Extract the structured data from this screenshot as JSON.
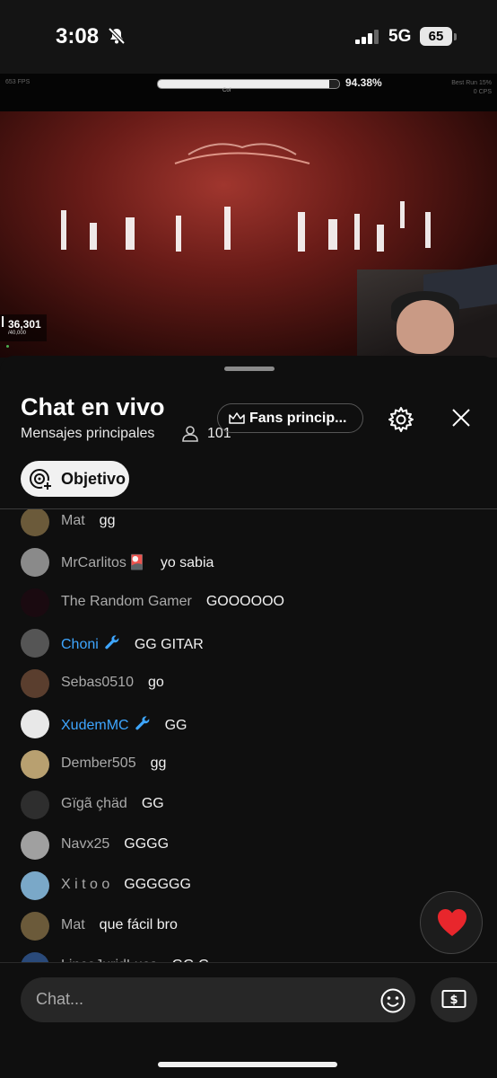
{
  "status_bar": {
    "time": "3:08",
    "network": "5G",
    "battery": "65"
  },
  "video": {
    "hud_fps": "653 FPS",
    "hud_label": "Cof",
    "hud_percent": "94.38%",
    "hud_progress": 0.9438,
    "hud_right": [
      "Best Run 15%",
      "0 CPS"
    ],
    "counter_main": "36,301",
    "counter_sub": "/40,000"
  },
  "chat": {
    "title": "Chat en vivo",
    "subtitle": "Mensajes principales",
    "viewer_count": "101",
    "fans_label": "Fans princip...",
    "goal_label": "Objetivo",
    "input_placeholder": "Chat..."
  },
  "messages": [
    {
      "author": "Mat",
      "text": "gg",
      "mod": false,
      "badge": "",
      "avatar_color": "#6b5a3a"
    },
    {
      "author": "MrCarlitos",
      "text": "yo sabia",
      "mod": false,
      "badge": "🎴",
      "avatar_color": "#8a8a8a"
    },
    {
      "author": "The Random Gamer",
      "text": "GOOOOOO",
      "mod": false,
      "badge": "",
      "avatar_color": "#1a0a10"
    },
    {
      "author": "Choni",
      "text": "GG GITAR",
      "mod": true,
      "badge": "",
      "avatar_color": "#555555"
    },
    {
      "author": "Sebas0510",
      "text": "go",
      "mod": false,
      "badge": "",
      "avatar_color": "#5a3e2e"
    },
    {
      "author": "XudemMC",
      "text": "GG",
      "mod": true,
      "badge": "",
      "avatar_color": "#e8e8e8"
    },
    {
      "author": "Dember505",
      "text": "gg",
      "mod": false,
      "badge": "",
      "avatar_color": "#b8a070"
    },
    {
      "author": "Gïgã çhäd",
      "text": "GG",
      "mod": false,
      "badge": "",
      "avatar_color": "#2e2e2e"
    },
    {
      "author": "Navx25",
      "text": "GGGG",
      "mod": false,
      "badge": "",
      "avatar_color": "#a0a0a0"
    },
    {
      "author": "X i t o o",
      "text": "GGGGGG",
      "mod": false,
      "badge": "",
      "avatar_color": "#7aa8c8"
    },
    {
      "author": "Mat",
      "text": "que fácil bro",
      "mod": false,
      "badge": "",
      "avatar_color": "#6b5a3a"
    },
    {
      "author": "LinceJuridLuca",
      "text": "GG G",
      "mod": false,
      "badge": "",
      "avatar_color": "#2a4a7a"
    }
  ],
  "colors": {
    "moderator": "#3ea6ff",
    "author": "#aaaaaa",
    "heart": "#e8262c"
  }
}
